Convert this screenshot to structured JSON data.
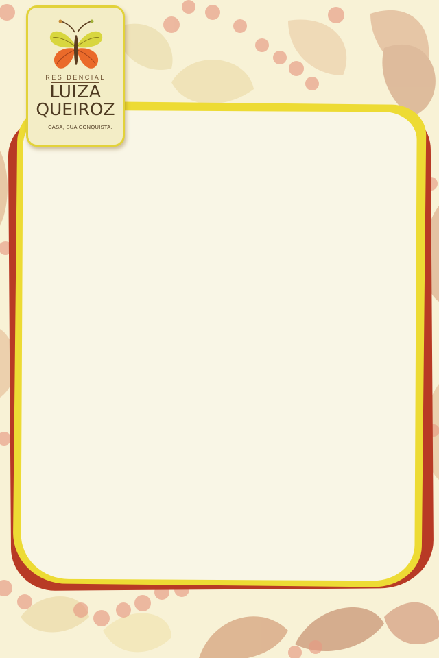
{
  "brand": {
    "kicker": "RESIDENCIAL",
    "name_line1": "LUIZA",
    "name_line2": "QUEIROZ",
    "tagline": "CASA, SUA CONQUISTA."
  },
  "colors": {
    "background": "#f8f2d6",
    "frame_outer": "#b83a25",
    "frame_inner": "#eddb34",
    "panel": "#f9f6e6",
    "logo_background": "#f3edc6",
    "logo_text": "#4e3a21"
  },
  "icons": {
    "logo": "butterfly-icon",
    "background_pattern": [
      "leaf",
      "berry-branch"
    ]
  }
}
